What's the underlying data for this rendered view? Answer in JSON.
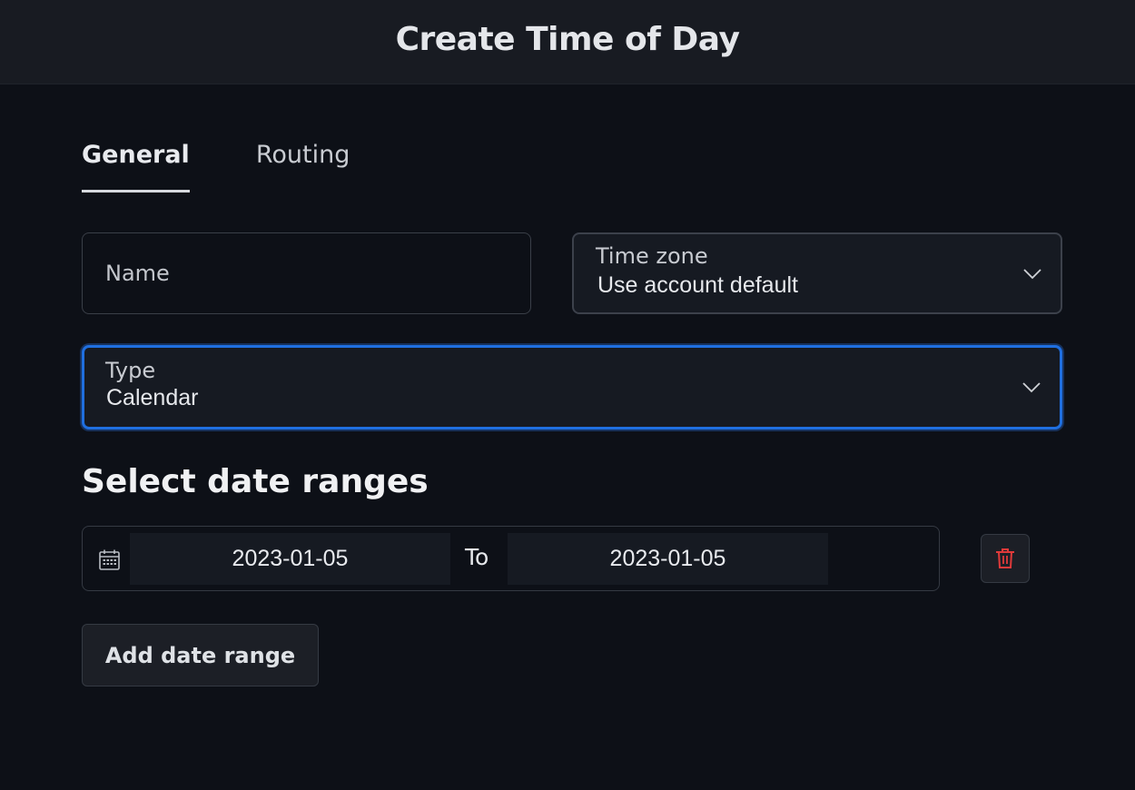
{
  "header": {
    "title": "Create Time of Day"
  },
  "tabs": [
    {
      "label": "General",
      "active": true
    },
    {
      "label": "Routing",
      "active": false
    }
  ],
  "form": {
    "name": {
      "placeholder": "Name",
      "value": ""
    },
    "time_zone": {
      "label": "Time zone",
      "value": "Use account default"
    },
    "type": {
      "label": "Type",
      "value": "Calendar"
    }
  },
  "date_ranges": {
    "title": "Select date ranges",
    "ranges": [
      {
        "from": "2023-01-05",
        "separator": "To",
        "to": "2023-01-05"
      }
    ],
    "add_button_label": "Add date range"
  },
  "icons": {
    "calendar": "calendar-icon",
    "delete": "trash-icon",
    "chevron": "chevron-down-icon"
  },
  "colors": {
    "background": "#0d1017",
    "header": "#181b22",
    "focus_border": "#1f6fe0",
    "delete_icon": "#e03a3a"
  }
}
